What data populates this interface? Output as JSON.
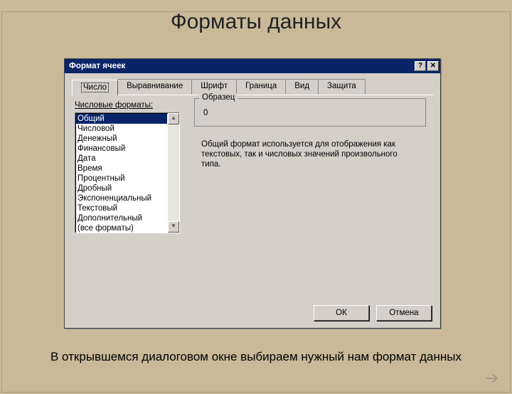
{
  "page_title": "Форматы данных",
  "caption": "В открывшемся диалоговом окне выбираем нужный нам формат данных",
  "dialog": {
    "title": "Формат ячеек",
    "help_label": "?",
    "close_label": "✕",
    "tabs": [
      {
        "label": "Число",
        "active": true
      },
      {
        "label": "Выравнивание",
        "active": false
      },
      {
        "label": "Шрифт",
        "active": false
      },
      {
        "label": "Граница",
        "active": false
      },
      {
        "label": "Вид",
        "active": false
      },
      {
        "label": "Защита",
        "active": false
      }
    ],
    "category_label": "Числовые форматы:",
    "categories": [
      "Общий",
      "Числовой",
      "Денежный",
      "Финансовый",
      "Дата",
      "Время",
      "Процентный",
      "Дробный",
      "Экспоненциальный",
      "Текстовый",
      "Дополнительный",
      "(все форматы)"
    ],
    "selected_index": 0,
    "sample": {
      "legend": "Образец",
      "value": "0"
    },
    "description": "Общий формат используется для отображения как текстовых, так и числовых значений произвольного типа.",
    "buttons": {
      "ok": "ОК",
      "cancel": "Отмена"
    }
  }
}
